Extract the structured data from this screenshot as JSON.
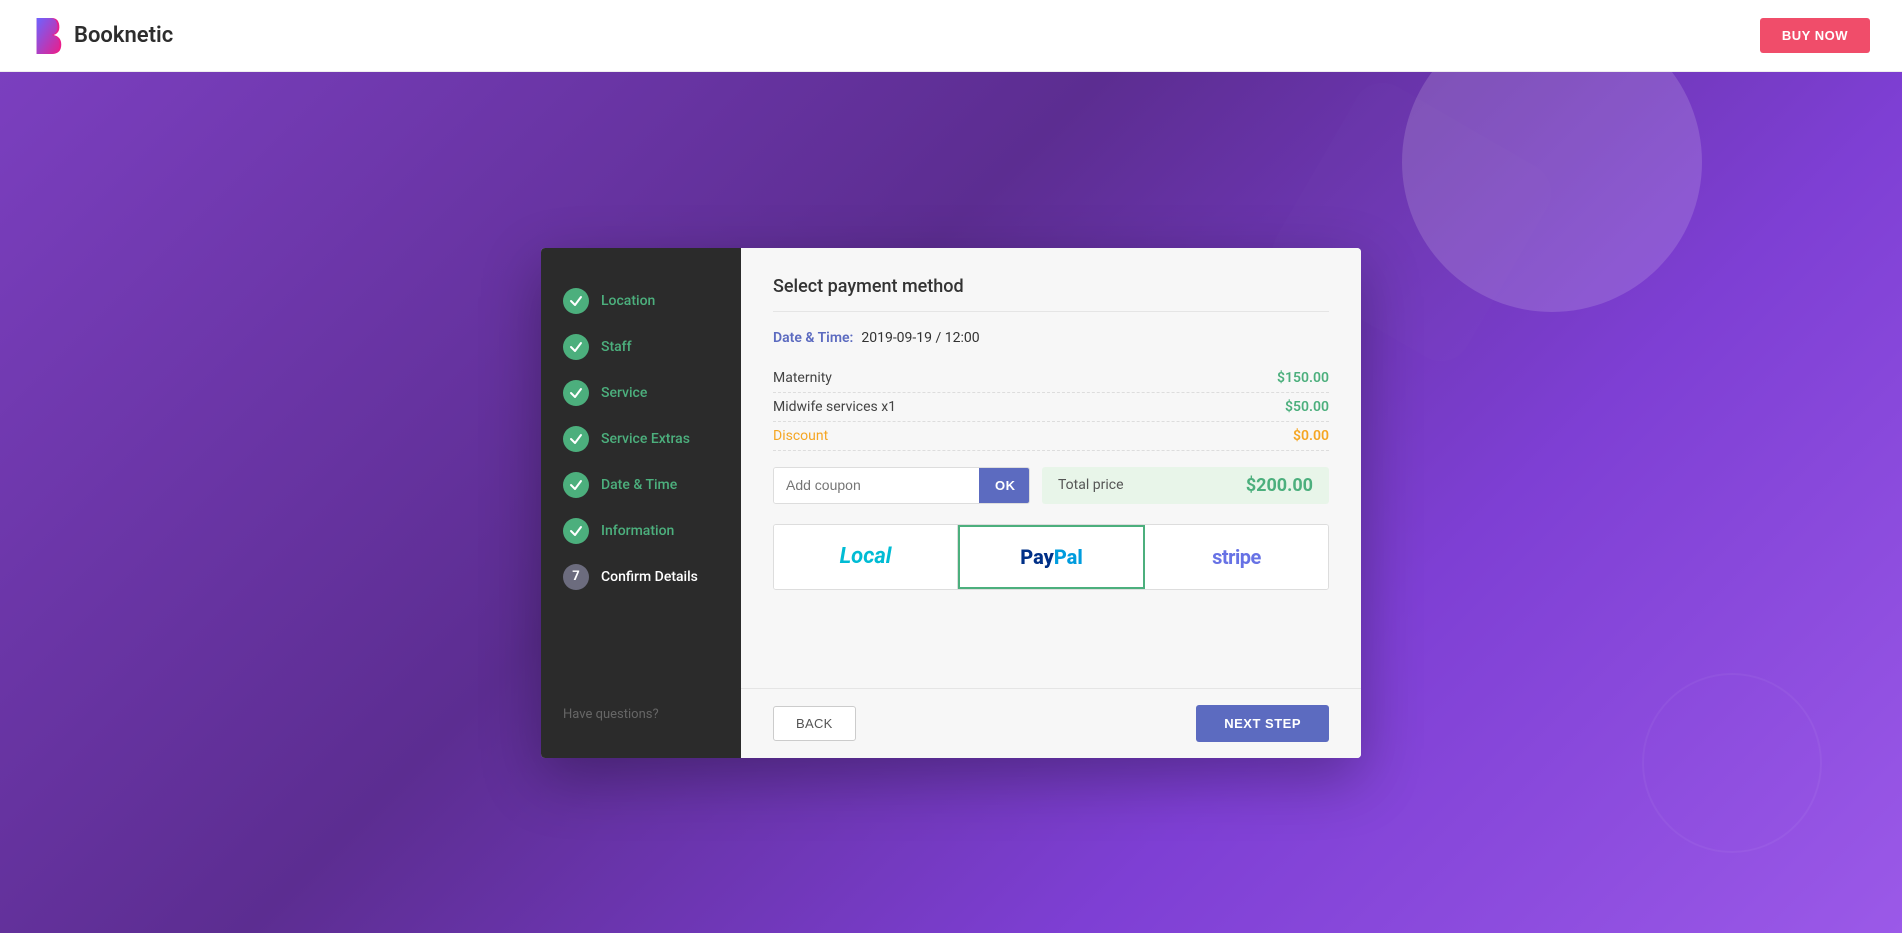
{
  "topnav": {
    "logo_text": "Booknetic",
    "buy_now_label": "BUY NOW"
  },
  "sidebar": {
    "steps": [
      {
        "id": "location",
        "label": "Location",
        "status": "completed",
        "number": "1"
      },
      {
        "id": "staff",
        "label": "Staff",
        "status": "completed",
        "number": "2"
      },
      {
        "id": "service",
        "label": "Service",
        "status": "completed",
        "number": "3"
      },
      {
        "id": "service_extras",
        "label": "Service Extras",
        "status": "completed",
        "number": "4"
      },
      {
        "id": "date_time",
        "label": "Date & Time",
        "status": "completed",
        "number": "5"
      },
      {
        "id": "information",
        "label": "Information",
        "status": "completed",
        "number": "6"
      },
      {
        "id": "confirm_details",
        "label": "Confirm Details",
        "status": "active",
        "number": "7"
      }
    ],
    "footer_text": "Have questions?"
  },
  "main": {
    "section_title": "Select payment method",
    "datetime_label": "Date & Time:",
    "datetime_value": "2019-09-19 / 12:00",
    "price_items": [
      {
        "name": "Maternity",
        "price": "$150.00",
        "type": "normal"
      },
      {
        "name": "Midwife services x1",
        "price": "$50.00",
        "type": "normal"
      },
      {
        "name": "Discount",
        "price": "$0.00",
        "type": "discount"
      }
    ],
    "coupon_placeholder": "Add coupon",
    "coupon_ok_label": "OK",
    "total_label": "Total price",
    "total_amount": "$200.00",
    "payment_methods": [
      {
        "id": "local",
        "label": "Local",
        "style": "local",
        "selected": false
      },
      {
        "id": "paypal",
        "label": "PayPal",
        "style": "paypal",
        "selected": true
      },
      {
        "id": "stripe",
        "label": "stripe",
        "style": "stripe",
        "selected": false
      }
    ],
    "back_label": "BACK",
    "next_label": "NEXT STEP"
  }
}
